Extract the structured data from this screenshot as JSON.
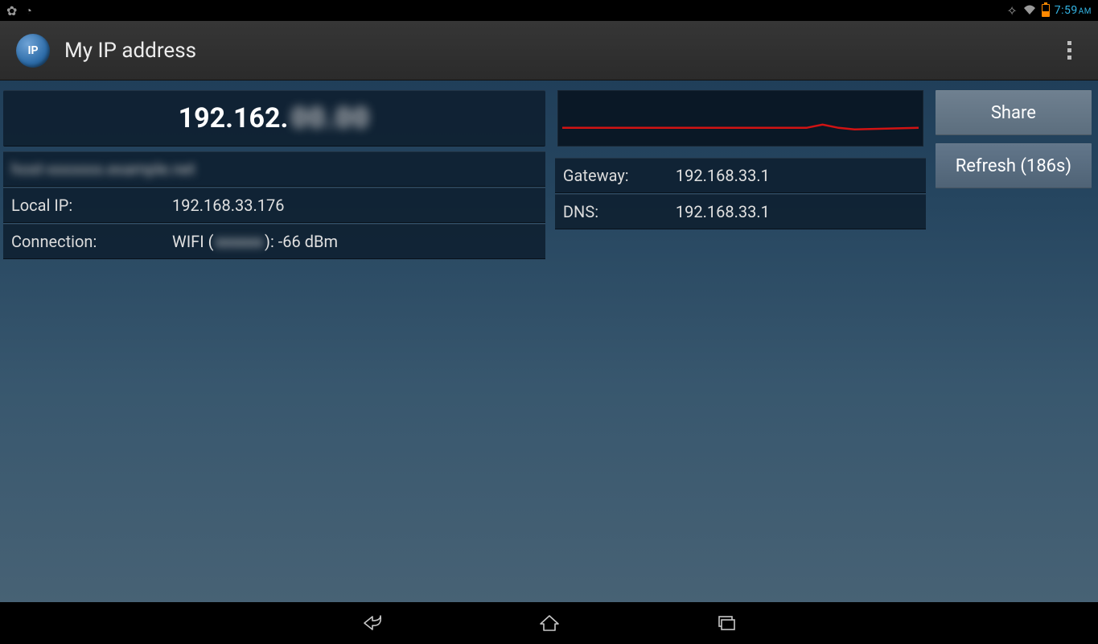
{
  "status": {
    "time": "7:59",
    "ampm": "AM"
  },
  "header": {
    "icon_text": "IP",
    "title": "My IP address"
  },
  "ip": {
    "public_prefix": "192.162.",
    "public_suffix_masked": "00.00",
    "hostname_masked": "host-xxxxxxx.example.net",
    "local_label": "Local IP:",
    "local_value": "192.168.33.176",
    "conn_label": "Connection:",
    "conn_prefix": "WIFI (",
    "conn_ssid_masked": "xxxxxx",
    "conn_suffix": "): -66 dBm"
  },
  "net": {
    "gateway_label": "Gateway:",
    "gateway_value": "192.168.33.1",
    "dns_label": "DNS:",
    "dns_value": "192.168.33.1"
  },
  "buttons": {
    "share": "Share",
    "refresh": "Refresh (186s)"
  }
}
